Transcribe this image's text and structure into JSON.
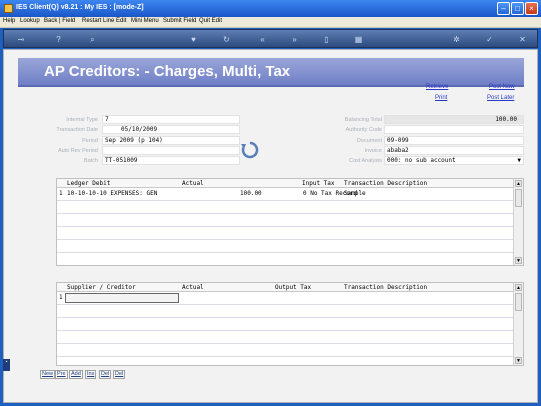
{
  "window": {
    "title": "IES Client(Q) v8.21 : My IES : [mode-Z]"
  },
  "menubar": [
    "Help",
    "Lookup",
    "Back | Field",
    "Restart Line Edit",
    "Mini Menu",
    "Submit Field",
    "Quit Edit"
  ],
  "page": {
    "title": "AP Creditors: - Charges, Multi, Tax"
  },
  "links": {
    "retrieve": "Retrieve",
    "print": "Print",
    "post_now": "Post Now",
    "post_later": "Post Later"
  },
  "left_fields": [
    {
      "label": "Internal Type",
      "value": "7"
    },
    {
      "label": "Transaction Date",
      "value": "05/10/2009"
    },
    {
      "label": "Period",
      "value": "Sep 2009 (p 104)"
    },
    {
      "label": "Auto Rev Period",
      "value": ""
    },
    {
      "label": "Batch",
      "value": "TT-051009"
    }
  ],
  "right_fields": [
    {
      "label": "Balancing Total",
      "value": "100.00"
    },
    {
      "label": "Authority Code",
      "value": ""
    },
    {
      "label": "Document",
      "value": "09-099"
    },
    {
      "label": "Invoice",
      "value": "ababa2"
    },
    {
      "label": "Cost Analysis",
      "value": "000: no sub account"
    }
  ],
  "ledger_grid": {
    "headers": [
      "Ledger Debit",
      "Actual",
      "Input Tax",
      "Transaction Description"
    ],
    "rows": [
      {
        "num": "1",
        "ledger": "10-10-10-10 EXPENSES: GEN",
        "actual": "100.00",
        "tax": "0 No Tax Record",
        "desc": "Sample"
      }
    ]
  },
  "supplier_grid": {
    "headers": [
      "Supplier / Creditor",
      "Actual",
      "Output Tax",
      "Transaction Description"
    ],
    "rows": [
      {
        "num": "1"
      }
    ]
  },
  "bottom_buttons": [
    "New",
    "Pre",
    "Add",
    "Ins",
    "Del",
    "Del"
  ],
  "toolbar_icons": [
    "key-icon",
    "help-icon",
    "search-icon",
    "heart-icon",
    "refresh-icon",
    "rewind-icon",
    "forward-icon",
    "document-icon",
    "calendar-icon",
    "settings-icon",
    "check-icon",
    "close-icon"
  ]
}
